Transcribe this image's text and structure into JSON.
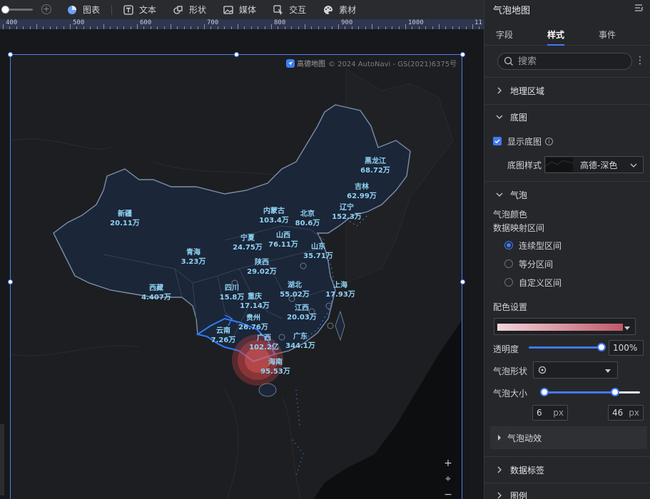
{
  "toolbar": {
    "items": [
      {
        "icon": "pie-chart-icon",
        "label": "图表"
      },
      {
        "icon": "text-icon",
        "label": "文本"
      },
      {
        "icon": "shape-icon",
        "label": "形状"
      },
      {
        "icon": "media-icon",
        "label": "媒体"
      },
      {
        "icon": "interaction-icon",
        "label": "交互"
      },
      {
        "icon": "palette-icon",
        "label": "素材"
      }
    ]
  },
  "ruler": {
    "labels": [
      "400",
      "500",
      "600",
      "700",
      "800",
      "900",
      "1000",
      "11"
    ]
  },
  "map": {
    "attribution_brand": "高德地图",
    "attribution_text": "© 2024 AutoNavi - GS(2021)6375号",
    "provinces": [
      {
        "name": "黑龙江",
        "value": "68.72万"
      },
      {
        "name": "吉林",
        "value": "62.99万"
      },
      {
        "name": "辽宁",
        "value": "152.3万"
      },
      {
        "name": "内蒙古",
        "value": "103.4万"
      },
      {
        "name": "北京",
        "value": "80.6万"
      },
      {
        "name": "新疆",
        "value": "20.11万"
      },
      {
        "name": "宁夏",
        "value": "24.75万"
      },
      {
        "name": "山西",
        "value": "76.11万"
      },
      {
        "name": "山东",
        "value": "35.71万"
      },
      {
        "name": "青海",
        "value": "3.23万"
      },
      {
        "name": "陕西",
        "value": "29.02万"
      },
      {
        "name": "西藏",
        "value": "4.407万"
      },
      {
        "name": "四川",
        "value": "15.8万"
      },
      {
        "name": "湖北",
        "value": "55.02万"
      },
      {
        "name": "上海",
        "value": "17.93万"
      },
      {
        "name": "重庆",
        "value": "17.14万"
      },
      {
        "name": "江西",
        "value": "20.03万"
      },
      {
        "name": "贵州",
        "value": "26.76万"
      },
      {
        "name": "云南",
        "value": "7.26万"
      },
      {
        "name": "广西",
        "value": "102.2亿"
      },
      {
        "name": "广东",
        "value": "344.1万"
      },
      {
        "name": "海南",
        "value": "95.53万"
      }
    ],
    "controls": {
      "zoom_in": "+",
      "locate": "⌖",
      "zoom_out": "−"
    }
  },
  "panel": {
    "title": "气泡地图",
    "tabs": [
      "字段",
      "样式",
      "事件"
    ],
    "active_tab": "样式",
    "search_placeholder": "搜索",
    "sections": {
      "geo_area": "地理区域",
      "basemap": "底图",
      "show_basemap": "显示底图",
      "basemap_style_label": "底图样式",
      "basemap_style_value": "高德-深色",
      "bubble": "气泡",
      "bubble_color": "气泡颜色",
      "mapping_range": "数据映射区间",
      "range_options": [
        "连续型区间",
        "等分区间",
        "自定义区间"
      ],
      "selected_range": "连续型区间",
      "color_setting": "配色设置",
      "opacity_label": "透明度",
      "opacity_value": "100%",
      "opacity_level": 1.0,
      "shape_label": "气泡形状",
      "size_label": "气泡大小",
      "size_min": "6",
      "size_max": "46",
      "size_unit": "px",
      "animation": "气泡动效",
      "data_labels": "数据标签",
      "legend": "图例"
    },
    "accent_color": "#3f7bf6",
    "ramp_colors": [
      "#f2d6dc",
      "#e8bcc5",
      "#dea3ae",
      "#d48a97",
      "#ca7180",
      "#c05869"
    ]
  }
}
